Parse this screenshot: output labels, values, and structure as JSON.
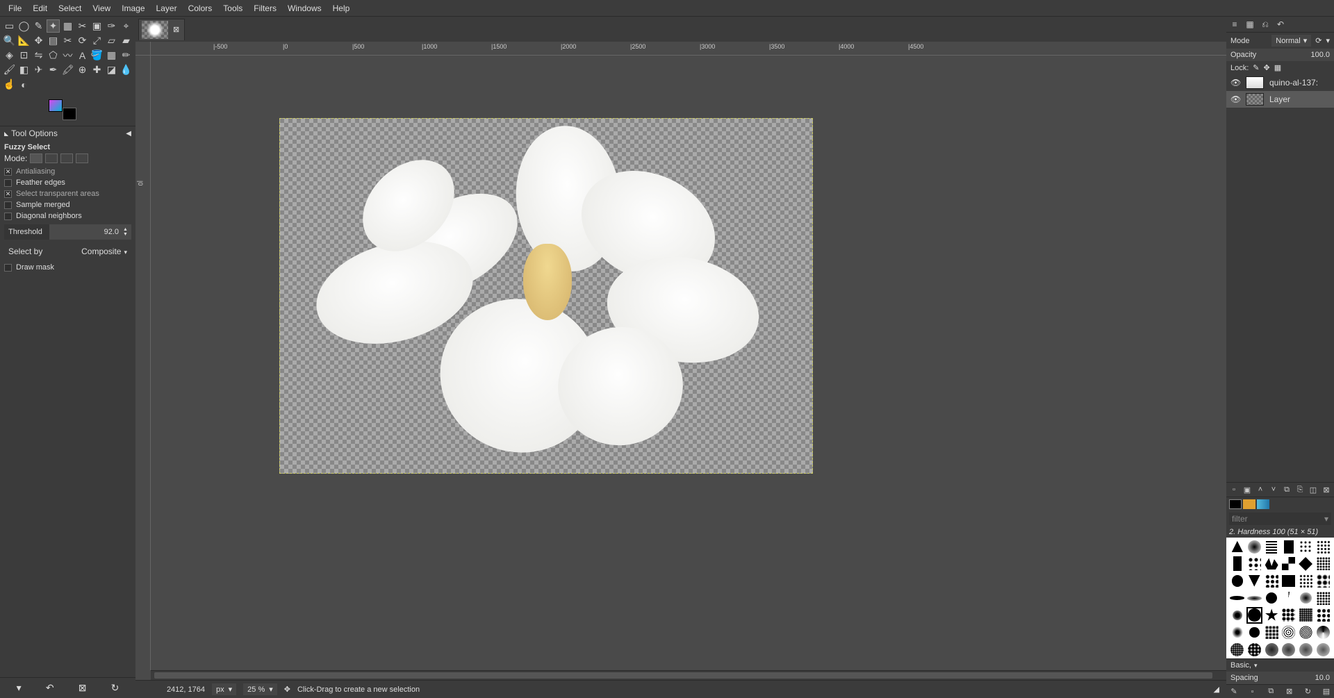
{
  "menu": [
    "File",
    "Edit",
    "Select",
    "View",
    "Image",
    "Layer",
    "Colors",
    "Tools",
    "Filters",
    "Windows",
    "Help"
  ],
  "toolOptions": {
    "panelTitle": "Tool Options",
    "toolName": "Fuzzy Select",
    "modeLabel": "Mode:",
    "antialiasing": {
      "label": "Antialiasing",
      "checked": true
    },
    "feather": {
      "label": "Feather edges",
      "checked": false
    },
    "transparent": {
      "label": "Select transparent areas",
      "checked": true
    },
    "sampleMerged": {
      "label": "Sample merged",
      "checked": false
    },
    "diagonal": {
      "label": "Diagonal neighbors",
      "checked": false
    },
    "thresholdLabel": "Threshold",
    "thresholdValue": "92.0",
    "selectByLabel": "Select by",
    "selectByValue": "Composite",
    "drawMask": {
      "label": "Draw mask",
      "checked": false
    }
  },
  "tab": {
    "closeGlyph": "⊠"
  },
  "ruler": {
    "hTicks": [
      "|-500",
      "|0",
      "|500",
      "|1000",
      "|1500",
      "|2000",
      "|2500",
      "|3000",
      "|3500",
      "|4000",
      "|4500"
    ]
  },
  "status": {
    "coords": "2412, 1764",
    "unit": "px",
    "zoom": "25 %",
    "hint": "Click-Drag to create a new selection"
  },
  "rightPanel": {
    "modeLabel": "Mode",
    "modeValue": "Normal",
    "opacityLabel": "Opacity",
    "opacityValue": "100.0",
    "lockLabel": "Lock:",
    "layers": [
      {
        "name": "quino-al-137:"
      },
      {
        "name": "Layer"
      }
    ],
    "filterPlaceholder": "filter",
    "brushTitle": "2. Hardness 100 (51 × 51)",
    "basicLabel": "Basic,",
    "spacingLabel": "Spacing",
    "spacingValue": "10.0"
  }
}
